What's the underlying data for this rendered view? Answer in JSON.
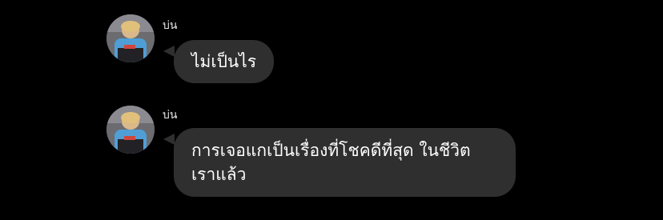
{
  "conversation": {
    "messages": [
      {
        "sender": "บ่น",
        "avatar_icon": "profile-avatar",
        "lines": [
          "ไม่เป็นไร"
        ]
      },
      {
        "sender": "บ่น",
        "avatar_icon": "profile-avatar",
        "lines": [
          "การเจอแกเป็นเรื่องที่โชคดีที่สุด ในชีวิต",
          "เราแล้ว"
        ]
      }
    ]
  },
  "colors": {
    "background": "#000000",
    "bubble": "#2f2f2f",
    "text": "#ffffff",
    "sender_text": "#e6e6e6"
  }
}
